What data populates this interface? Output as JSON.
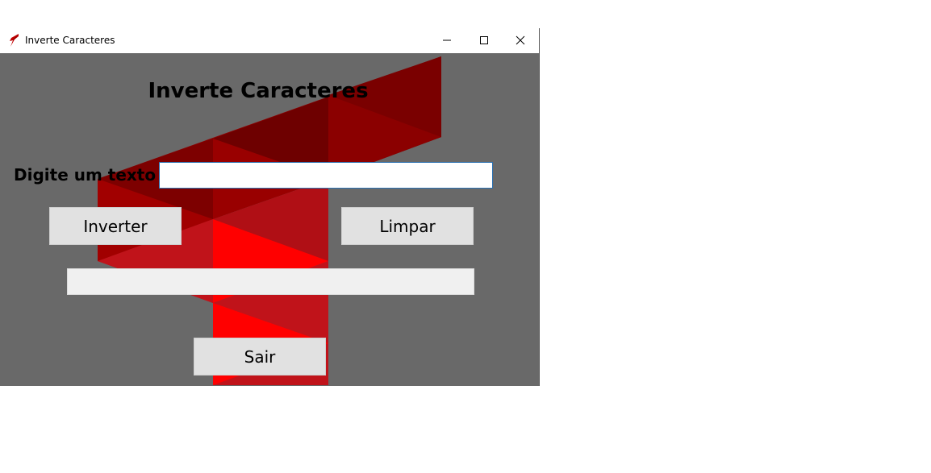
{
  "window": {
    "title": "Inverte Caracteres",
    "icon": "red-feather-icon"
  },
  "main": {
    "heading": "Inverte Caracteres",
    "input_label": "Digite um texto",
    "input_value": "",
    "output_value": "",
    "buttons": {
      "inverter": "Inverter",
      "limpar": "Limpar",
      "sair": "Sair"
    }
  },
  "colors": {
    "background": "#696969",
    "accent_red": "#ff0000",
    "dark_red": "#6e0000"
  }
}
